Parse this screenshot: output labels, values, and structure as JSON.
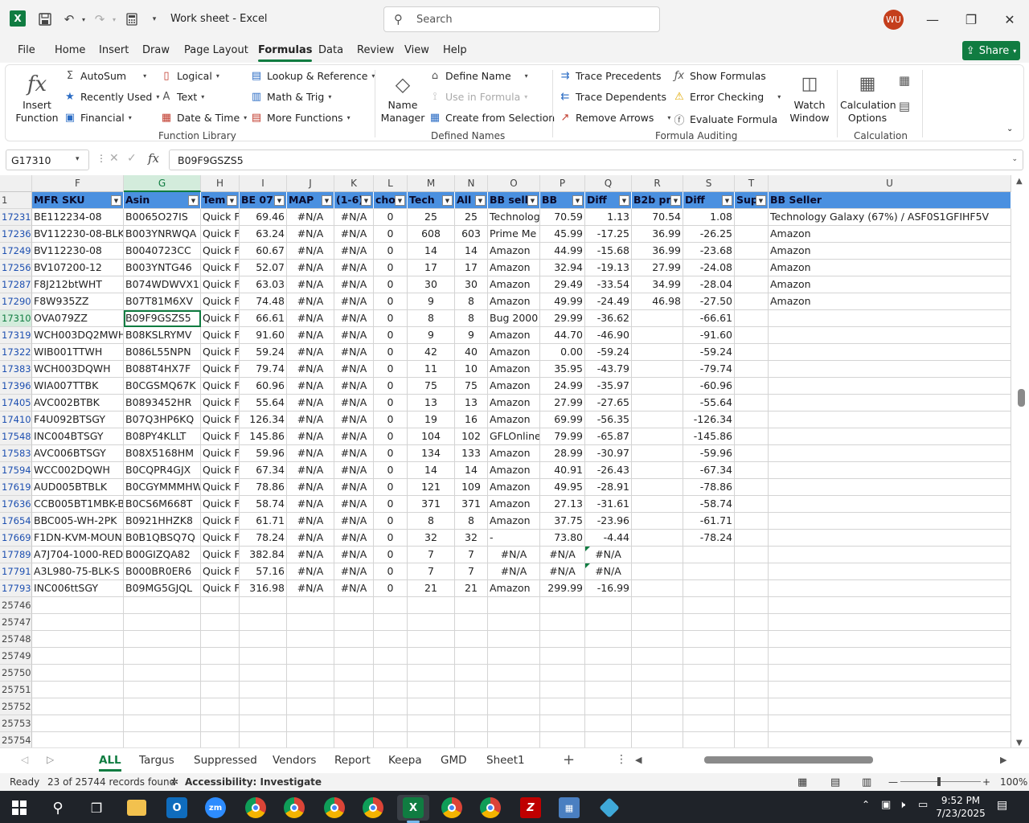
{
  "app": {
    "title": "Work sheet  -  Excel",
    "search_placeholder": "Search",
    "user_initials": "WU"
  },
  "menu": {
    "tabs": [
      "File",
      "Home",
      "Insert",
      "Draw",
      "Page Layout",
      "Formulas",
      "Data",
      "Review",
      "View",
      "Help"
    ],
    "active": "Formulas",
    "share_label": "Share"
  },
  "ribbon": {
    "insert_function": "Insert Function",
    "autosum": "AutoSum",
    "recently_used": "Recently Used",
    "financial": "Financial",
    "logical": "Logical",
    "text": "Text",
    "date_time": "Date & Time",
    "lookup_reference": "Lookup & Reference",
    "math_trig": "Math & Trig",
    "more_functions": "More Functions",
    "group_function_library": "Function Library",
    "name_manager": "Name Manager",
    "define_name": "Define Name",
    "use_in_formula": "Use in Formula",
    "create_from_selection": "Create from Selection",
    "group_defined_names": "Defined Names",
    "trace_precedents": "Trace Precedents",
    "trace_dependents": "Trace Dependents",
    "remove_arrows": "Remove Arrows",
    "show_formulas": "Show Formulas",
    "error_checking": "Error Checking",
    "evaluate_formula": "Evaluate Formula",
    "watch_window": "Watch Window",
    "group_formula_auditing": "Formula Auditing",
    "calculation_options": "Calculation Options",
    "group_calculation": "Calculation"
  },
  "formula_bar": {
    "name_box": "G17310",
    "content": "B09F9GSZS5"
  },
  "grid": {
    "columns": [
      "F",
      "G",
      "H",
      "I",
      "J",
      "K",
      "L",
      "M",
      "N",
      "O",
      "P",
      "Q",
      "R",
      "S",
      "T",
      "U"
    ],
    "header_row_number": "1",
    "headers": [
      "MFR SKU",
      "Asin",
      "Tem",
      "BE 07",
      "MAP",
      "(1-6)",
      "cho",
      "Tech",
      "All",
      "BB sell",
      "BB",
      "Diff",
      "B2b pr",
      "Diff",
      "Sup",
      "BB Seller"
    ],
    "rows": [
      {
        "n": "17231",
        "cells": [
          "BE112234-08",
          "B0065O27IS",
          "Quick F",
          "69.46",
          "#N/A",
          "#N/A",
          "0",
          "25",
          "25",
          "Technolog",
          "70.59",
          "1.13",
          "70.54",
          "1.08",
          "",
          "Technology Galaxy (67%) / ASF0S1GFIHF5V"
        ]
      },
      {
        "n": "17236",
        "cells": [
          "BV112230-08-BLK",
          "B003YNRWQA",
          "Quick F",
          "63.24",
          "#N/A",
          "#N/A",
          "0",
          "608",
          "603",
          "Prime Me",
          "45.99",
          "-17.25",
          "36.99",
          "-26.25",
          "",
          "Amazon"
        ]
      },
      {
        "n": "17249",
        "cells": [
          "BV112230-08",
          "B0040723CC",
          "Quick F",
          "60.67",
          "#N/A",
          "#N/A",
          "0",
          "14",
          "14",
          "Amazon",
          "44.99",
          "-15.68",
          "36.99",
          "-23.68",
          "",
          "Amazon"
        ]
      },
      {
        "n": "17256",
        "cells": [
          "BV107200-12",
          "B003YNTG46",
          "Quick F",
          "52.07",
          "#N/A",
          "#N/A",
          "0",
          "17",
          "17",
          "Amazon",
          "32.94",
          "-19.13",
          "27.99",
          "-24.08",
          "",
          "Amazon"
        ]
      },
      {
        "n": "17287",
        "cells": [
          "F8J212btWHT",
          "B074WDWVX1",
          "Quick F",
          "63.03",
          "#N/A",
          "#N/A",
          "0",
          "30",
          "30",
          "Amazon",
          "29.49",
          "-33.54",
          "34.99",
          "-28.04",
          "",
          "Amazon"
        ]
      },
      {
        "n": "17290",
        "cells": [
          "F8W935ZZ",
          "B07T81M6XV",
          "Quick F",
          "74.48",
          "#N/A",
          "#N/A",
          "0",
          "9",
          "8",
          "Amazon",
          "49.99",
          "-24.49",
          "46.98",
          "-27.50",
          "",
          "Amazon"
        ]
      },
      {
        "n": "17310",
        "cells": [
          "OVA079ZZ",
          "B09F9GSZS5",
          "Quick F",
          "66.61",
          "#N/A",
          "#N/A",
          "0",
          "8",
          "8",
          "Bug 2000 (",
          "29.99",
          "-36.62",
          "",
          "-66.61",
          "",
          ""
        ]
      },
      {
        "n": "17319",
        "cells": [
          "WCH003DQ2MWH",
          "B08KSLRYMV",
          "Quick F",
          "91.60",
          "#N/A",
          "#N/A",
          "0",
          "9",
          "9",
          "Amazon",
          "44.70",
          "-46.90",
          "",
          "-91.60",
          "",
          ""
        ]
      },
      {
        "n": "17322",
        "cells": [
          "WIB001TTWH",
          "B086L55NPN",
          "Quick F",
          "59.24",
          "#N/A",
          "#N/A",
          "0",
          "42",
          "40",
          "Amazon",
          "0.00",
          "-59.24",
          "",
          "-59.24",
          "",
          ""
        ]
      },
      {
        "n": "17383",
        "cells": [
          "WCH003DQWH",
          "B088T4HX7F",
          "Quick F",
          "79.74",
          "#N/A",
          "#N/A",
          "0",
          "11",
          "10",
          "Amazon",
          "35.95",
          "-43.79",
          "",
          "-79.74",
          "",
          ""
        ]
      },
      {
        "n": "17396",
        "cells": [
          "WIA007TTBK",
          "B0CGSMQ67K",
          "Quick F",
          "60.96",
          "#N/A",
          "#N/A",
          "0",
          "75",
          "75",
          "Amazon",
          "24.99",
          "-35.97",
          "",
          "-60.96",
          "",
          ""
        ]
      },
      {
        "n": "17405",
        "cells": [
          "AVC002BTBK",
          "B0893452HR",
          "Quick F",
          "55.64",
          "#N/A",
          "#N/A",
          "0",
          "13",
          "13",
          "Amazon",
          "27.99",
          "-27.65",
          "",
          "-55.64",
          "",
          ""
        ]
      },
      {
        "n": "17410",
        "cells": [
          "F4U092BTSGY",
          "B07Q3HP6KQ",
          "Quick F",
          "126.34",
          "#N/A",
          "#N/A",
          "0",
          "19",
          "16",
          "Amazon",
          "69.99",
          "-56.35",
          "",
          "-126.34",
          "",
          ""
        ]
      },
      {
        "n": "17548",
        "cells": [
          "INC004BTSGY",
          "B08PY4KLLT",
          "Quick F",
          "145.86",
          "#N/A",
          "#N/A",
          "0",
          "104",
          "102",
          "GFLOnline",
          "79.99",
          "-65.87",
          "",
          "-145.86",
          "",
          ""
        ]
      },
      {
        "n": "17583",
        "cells": [
          "AVC006BTSGY",
          "B08X5168HM",
          "Quick F",
          "59.96",
          "#N/A",
          "#N/A",
          "0",
          "134",
          "133",
          "Amazon",
          "28.99",
          "-30.97",
          "",
          "-59.96",
          "",
          ""
        ]
      },
      {
        "n": "17594",
        "cells": [
          "WCC002DQWH",
          "B0CQPR4GJX",
          "Quick F",
          "67.34",
          "#N/A",
          "#N/A",
          "0",
          "14",
          "14",
          "Amazon",
          "40.91",
          "-26.43",
          "",
          "-67.34",
          "",
          ""
        ]
      },
      {
        "n": "17619",
        "cells": [
          "AUD005BTBLK",
          "B0CGYMMMHW",
          "Quick F",
          "78.86",
          "#N/A",
          "#N/A",
          "0",
          "121",
          "109",
          "Amazon",
          "49.95",
          "-28.91",
          "",
          "-78.86",
          "",
          ""
        ]
      },
      {
        "n": "17636",
        "cells": [
          "CCB005BT1MBK-B6",
          "B0CS6M668T",
          "Quick F",
          "58.74",
          "#N/A",
          "#N/A",
          "0",
          "371",
          "371",
          "Amazon",
          "27.13",
          "-31.61",
          "",
          "-58.74",
          "",
          ""
        ]
      },
      {
        "n": "17654",
        "cells": [
          "BBC005-WH-2PK",
          "B0921HHZK8",
          "Quick F",
          "61.71",
          "#N/A",
          "#N/A",
          "0",
          "8",
          "8",
          "Amazon",
          "37.75",
          "-23.96",
          "",
          "-61.71",
          "",
          ""
        ]
      },
      {
        "n": "17669",
        "cells": [
          "F1DN-KVM-MOUN",
          "B0B1QBSQ7Q",
          "Quick F",
          "78.24",
          "#N/A",
          "#N/A",
          "0",
          "32",
          "32",
          "-",
          "73.80",
          "-4.44",
          "",
          "-78.24",
          "",
          ""
        ]
      },
      {
        "n": "17789",
        "cells": [
          "A7J704-1000-RED",
          "B00GIZQA82",
          "Quick F",
          "382.84",
          "#N/A",
          "#N/A",
          "0",
          "7",
          "7",
          "#N/A",
          "#N/A",
          "#N/A",
          "",
          "",
          "",
          ""
        ]
      },
      {
        "n": "17791",
        "cells": [
          "A3L980-75-BLK-S",
          "B000BR0ER6",
          "Quick F",
          "57.16",
          "#N/A",
          "#N/A",
          "0",
          "7",
          "7",
          "#N/A",
          "#N/A",
          "#N/A",
          "",
          "",
          "",
          ""
        ]
      },
      {
        "n": "17793",
        "cells": [
          "INC006ttSGY",
          "B09MG5GJQL",
          "Quick F",
          "316.98",
          "#N/A",
          "#N/A",
          "0",
          "21",
          "21",
          "Amazon",
          "299.99",
          "-16.99",
          "",
          "",
          "",
          ""
        ]
      }
    ],
    "empty_rows": [
      "25746",
      "25747",
      "25748",
      "25749",
      "25750",
      "25751",
      "25752",
      "25753",
      "25754"
    ]
  },
  "sheets": {
    "tabs": [
      "ALL",
      "Targus",
      "Suppressed",
      "Vendors",
      "Report",
      "Keepa",
      "GMD",
      "Sheet1"
    ],
    "active": "ALL"
  },
  "status": {
    "ready": "Ready",
    "records": "23 of 25744 records found",
    "accessibility": "Accessibility: Investigate",
    "zoom": "100%"
  },
  "taskbar": {
    "time": "9:52 PM",
    "date": "7/23/2025"
  },
  "colors": {
    "accent": "#107c41",
    "header_fill": "#4a90e0",
    "taskbar": "#1f2329"
  }
}
